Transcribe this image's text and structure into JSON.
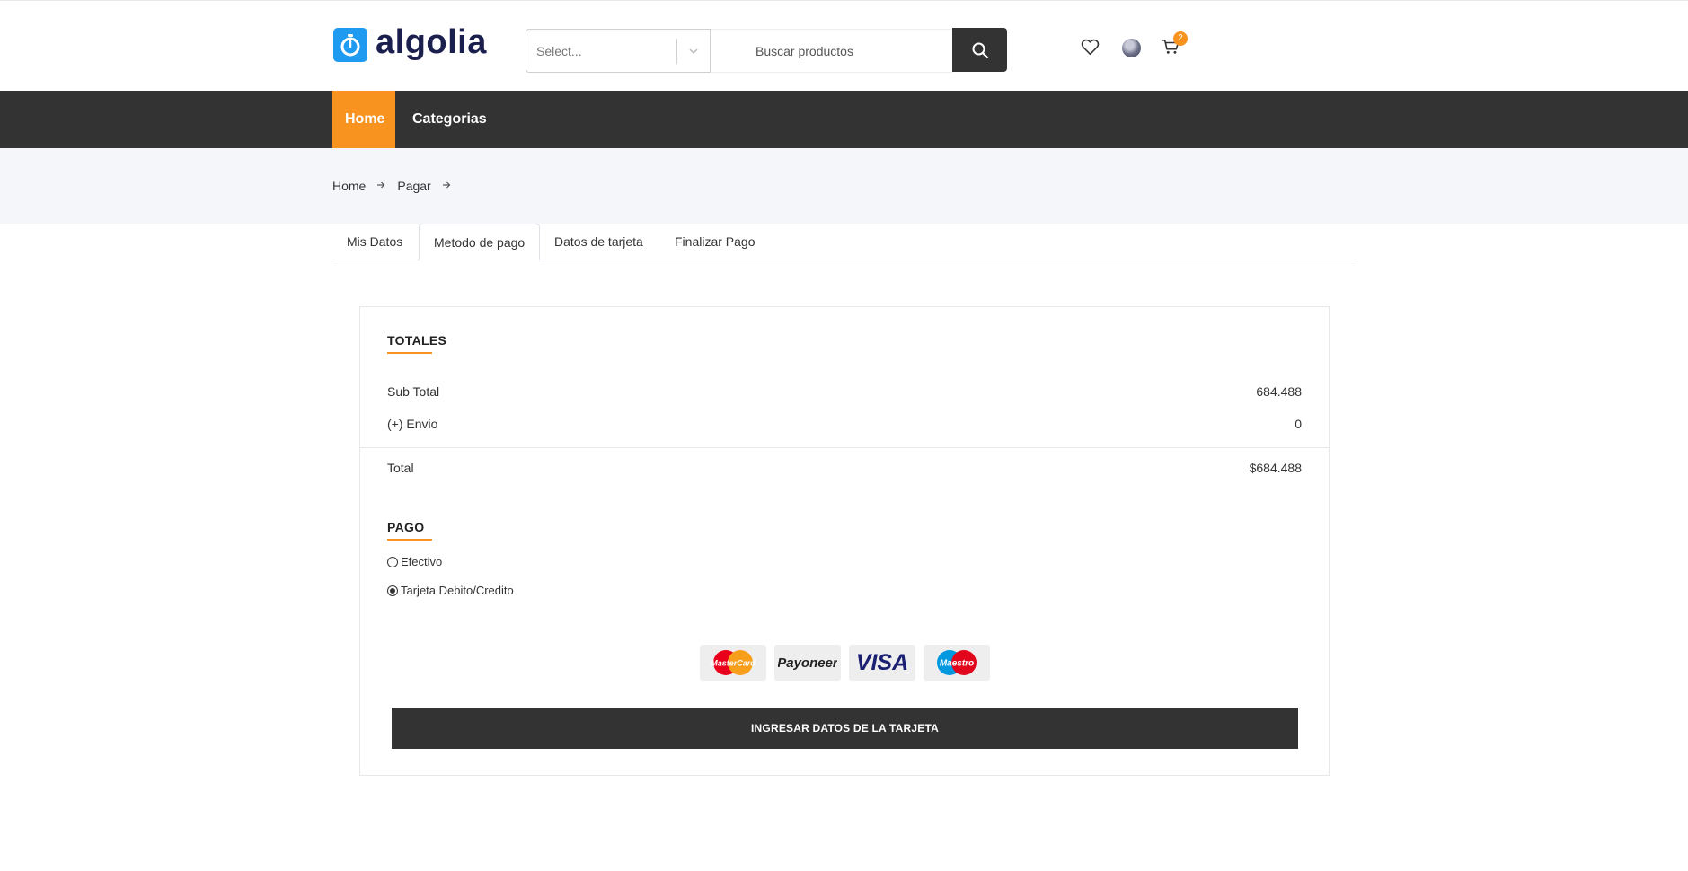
{
  "header": {
    "logo_text": "algolia",
    "category_select": {
      "placeholder": "Select..."
    },
    "search": {
      "placeholder": "Buscar productos"
    },
    "cart_count": "2"
  },
  "nav": {
    "items": [
      {
        "label": "Home",
        "active": true
      },
      {
        "label": "Categorias",
        "active": false
      }
    ]
  },
  "breadcrumb": {
    "items": [
      "Home",
      "Pagar"
    ]
  },
  "tabs": [
    {
      "label": "Mis Datos",
      "active": false
    },
    {
      "label": "Metodo de pago",
      "active": true
    },
    {
      "label": "Datos de tarjeta",
      "active": false
    },
    {
      "label": "Finalizar Pago",
      "active": false
    }
  ],
  "totals": {
    "title": "TOTALES",
    "subtotal_label": "Sub Total",
    "subtotal_value": "684.488",
    "shipping_label": "(+) Envio",
    "shipping_value": "0",
    "total_label": "Total",
    "total_value": "$684.488"
  },
  "payment": {
    "title": "PAGO",
    "options": [
      {
        "label": "Efectivo",
        "checked": false
      },
      {
        "label": "Tarjeta Debito/Credito",
        "checked": true
      }
    ],
    "card_logos": [
      {
        "name": "mastercard-logo",
        "text": "MasterCard"
      },
      {
        "name": "payoneer-logo",
        "text": "Payoneer"
      },
      {
        "name": "visa-logo",
        "text": "VISA"
      },
      {
        "name": "maestro-logo",
        "text": "Maestro"
      }
    ],
    "cta_label": "INGRESAR DATOS DE LA TARJETA"
  },
  "colors": {
    "accent": "#f7931e",
    "dark": "#333333",
    "logo_blue": "#1e9bf0",
    "band": "#f5f6fa"
  }
}
